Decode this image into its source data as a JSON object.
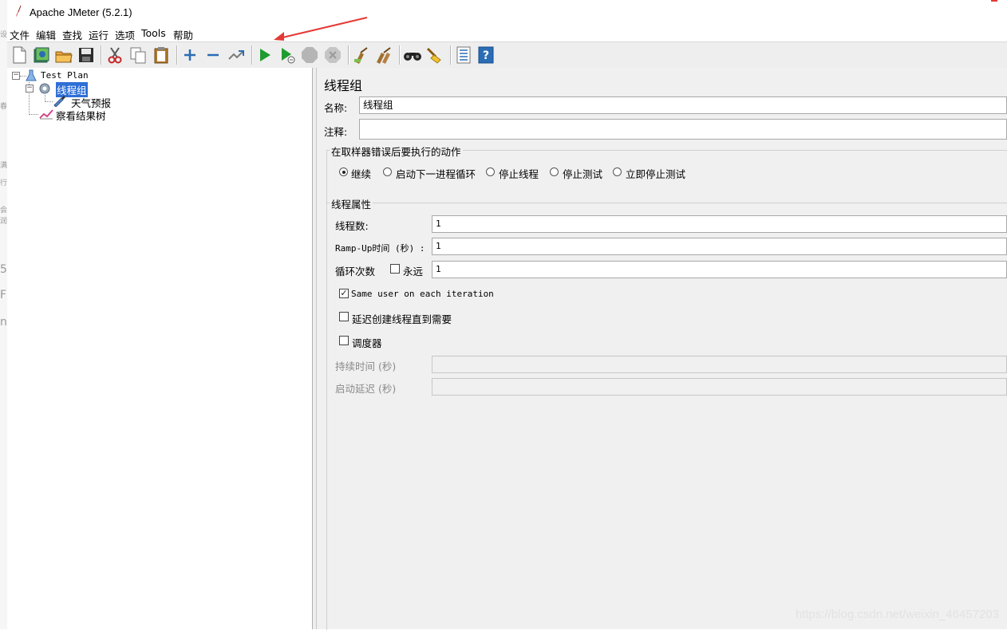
{
  "window": {
    "title": "Apache JMeter (5.2.1)"
  },
  "menu": [
    "文件",
    "编辑",
    "查找",
    "运行",
    "选项",
    "Tools",
    "帮助"
  ],
  "toolbar": [
    "new-icon",
    "templates-icon",
    "open-icon",
    "save-icon",
    "cut-icon",
    "copy-icon",
    "paste-icon",
    "expand-icon",
    "collapse-icon",
    "toggle-icon",
    "start-icon",
    "start-no-pauses-icon",
    "stop-icon",
    "shutdown-icon",
    "clear-icon",
    "clear-all-icon",
    "search-icon",
    "reset-search-icon",
    "function-helper-icon",
    "help-icon"
  ],
  "tree": {
    "root": "Test Plan",
    "thread_group": "线程组",
    "sampler": "天气预报",
    "listener": "察看结果树"
  },
  "panel": {
    "title": "线程组",
    "name_label": "名称:",
    "name_value": "线程组",
    "comment_label": "注释:",
    "comment_value": "",
    "on_error": {
      "title": "在取样器错误后要执行的动作",
      "options": [
        "继续",
        "启动下一进程循环",
        "停止线程",
        "停止测试",
        "立即停止测试"
      ],
      "selected": "继续"
    },
    "props": {
      "title": "线程属性",
      "threads_label": "线程数:",
      "threads_value": "1",
      "rampup_label": "Ramp-Up时间 (秒) :",
      "rampup_value": "1",
      "loop_label": "循环次数",
      "forever_label": "永远",
      "forever_checked": false,
      "loop_value": "1",
      "same_user_label": "Same user on each iteration",
      "same_user_checked": true,
      "delay_label": "延迟创建线程直到需要",
      "delay_checked": false,
      "scheduler_label": "调度器",
      "scheduler_checked": false,
      "duration_label": "持续时间 (秒)",
      "duration_value": "",
      "startup_delay_label": "启动延迟 (秒)",
      "startup_delay_value": ""
    }
  },
  "watermark": "https://blog.csdn.net/weixin_46457203",
  "colors": {
    "selection": "#2f6fd6",
    "arrow": "#e53935",
    "play": "#1e9c2f"
  }
}
